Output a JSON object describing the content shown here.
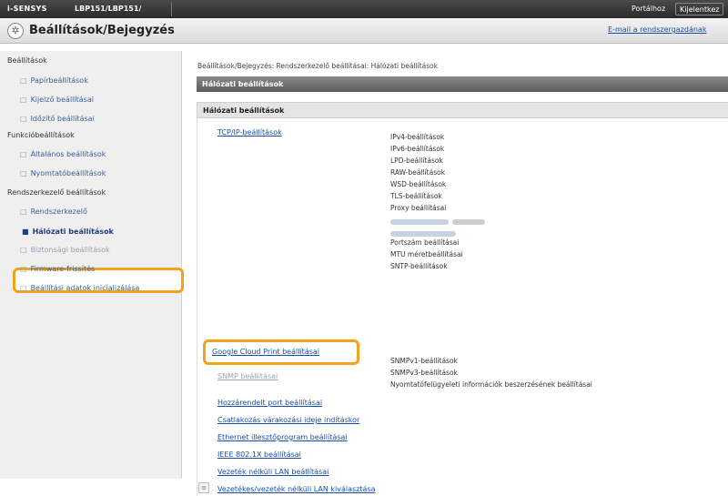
{
  "topbar": {
    "brand": "i-SENSYS",
    "model": "LBP151/LBP151/",
    "portal": "Portálhoz",
    "logout": "Kijelentkez"
  },
  "titlebar": {
    "title": "Beállítások/Bejegyzés",
    "email_link": "E-mail a rendszergazdának"
  },
  "sidebar": {
    "groups": {
      "settings": "Beállítások",
      "function": "Funkcióbeállítások",
      "admin": "Rendszerkezelő beállítások"
    },
    "items": [
      {
        "label": "Papírbeállítások"
      },
      {
        "label": "Kijelző beállításai"
      },
      {
        "label": "Időzítő beállításai"
      },
      {
        "label": "Általános beállítások"
      },
      {
        "label": "Nyomtatóbeállítások"
      },
      {
        "label": "Rendszerkezelő"
      },
      {
        "label": "Hálózati beállítások"
      },
      {
        "label": "Biztonsági beállítások"
      },
      {
        "label": "Firmware-frissítés"
      },
      {
        "label": "Beállítási adatok inicializálása"
      }
    ]
  },
  "main": {
    "breadcrumb": "Beállítások/Bejegyzés: Rendszerkezelő beállításai: Hálózati beállítások",
    "header1": "Hálózati beállítások",
    "header2": "Hálózati beállítások",
    "links": {
      "tcpip": "TCP/IP-beállítások",
      "gcp": "Google Cloud Print beállításai",
      "snmp": "SNMP beállításai",
      "dedicated_port": "Hozzárendelt port beállításai",
      "wait_time": "Csatlakozás várakozási ideje indításkor",
      "ethernet": "Ethernet illesztőprogram beállításai",
      "ieee": "IEEE 802.1X beállításai",
      "wlan": "Vezeték nélküli LAN beállításai",
      "wired_wireless": "Vezetékes/vezeték nélküli LAN kiválasztása"
    },
    "tcpip_subs": [
      "IPv4-beállítások",
      "IPv6-beállítások",
      "LPD-beállítások",
      "RAW-beállítások",
      "WSD-beállítások",
      "TLS-beállítások",
      "Proxy beállításai",
      "Portszám beállításai",
      "MTU méretbeállításai",
      "SNTP-beállítások"
    ],
    "snmp_subs": [
      "SNMPv1-beállítások",
      "SNMPv3-beállítások",
      "Nyomtatófelügyeleti információk beszerzésének beállításai"
    ]
  }
}
